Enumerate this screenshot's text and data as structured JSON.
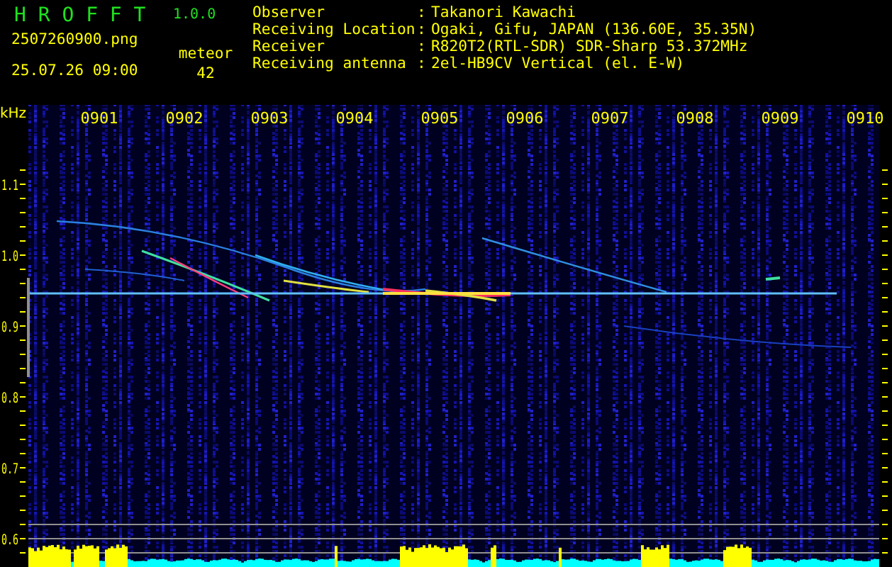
{
  "app": {
    "title": "H R O F F T",
    "version": "1.0.0"
  },
  "file_name": "2507260900.png",
  "timestamp": "25.07.26 09:00",
  "meteor": {
    "label": "meteor",
    "count": "42"
  },
  "info": [
    {
      "label": "Observer",
      "separator": ":",
      "value": "Takanori Kawachi"
    },
    {
      "label": "Receiving Location",
      "separator": ":",
      "value": "Ogaki, Gifu, JAPAN (136.60E, 35.35N)"
    },
    {
      "label": "Receiver",
      "separator": ":",
      "value": "R820T2(RTL-SDR) SDR-Sharp 53.372MHz"
    },
    {
      "label": "Receiving antenna",
      "separator": ":",
      "value": "2el-HB9CV Vertical (el. E-W)"
    }
  ],
  "spectrogram": {
    "unit": "kHz",
    "time_labels": [
      "0901",
      "0902",
      "0903",
      "0904",
      "0905",
      "0906",
      "0907",
      "0908",
      "0909",
      "0910"
    ],
    "frequency_labels": [
      "1.1",
      "1.0",
      "0.9",
      "0.8",
      "0.7",
      "0.6"
    ]
  }
}
